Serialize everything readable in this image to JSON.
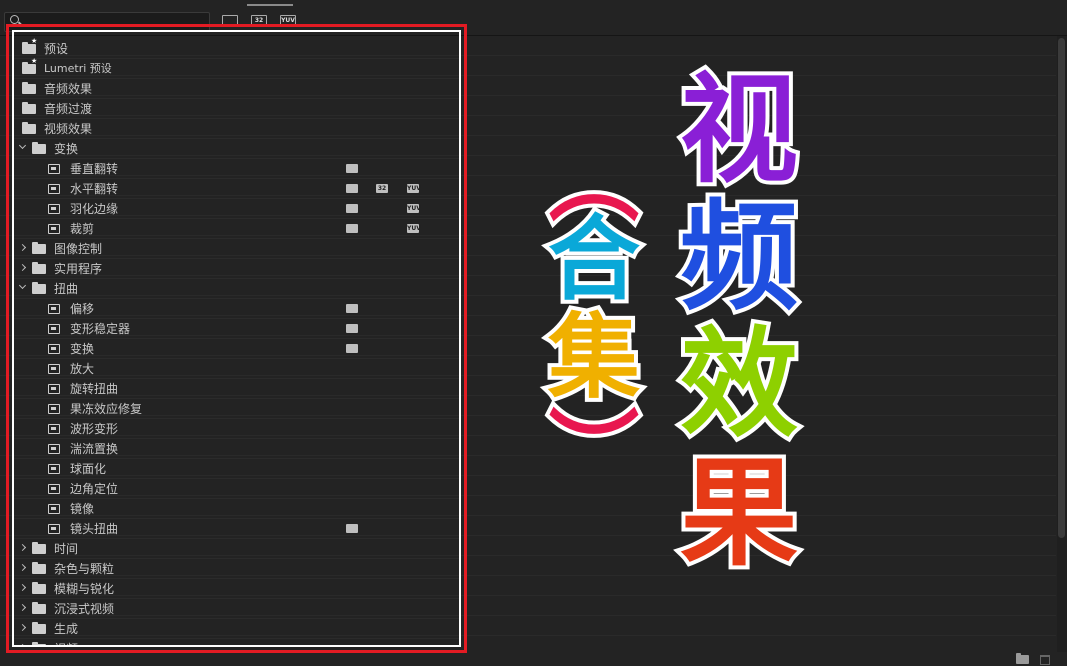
{
  "toolbar": {
    "search_placeholder": "",
    "filters": [
      {
        "label": "",
        "name": "accelerated-filter"
      },
      {
        "label": "32",
        "name": "32bit-filter"
      },
      {
        "label": "YUV",
        "name": "yuv-filter"
      }
    ]
  },
  "tree": [
    {
      "label": "预设",
      "indent": 0,
      "type": "folder-star",
      "chevron": "none",
      "badges": []
    },
    {
      "label": "Lumetri 预设",
      "indent": 0,
      "type": "folder-star",
      "chevron": "none",
      "badges": []
    },
    {
      "label": "音频效果",
      "indent": 0,
      "type": "folder",
      "chevron": "none",
      "badges": []
    },
    {
      "label": "音频过渡",
      "indent": 0,
      "type": "folder",
      "chevron": "none",
      "badges": []
    },
    {
      "label": "视频效果",
      "indent": 0,
      "type": "folder",
      "chevron": "none",
      "badges": []
    },
    {
      "label": "变换",
      "indent": 1,
      "type": "folder",
      "chevron": "expanded",
      "badges": []
    },
    {
      "label": "垂直翻转",
      "indent": 2,
      "type": "effect",
      "chevron": "none",
      "badges": [
        "accel"
      ]
    },
    {
      "label": "水平翻转",
      "indent": 2,
      "type": "effect",
      "chevron": "none",
      "badges": [
        "accel",
        "32",
        "yuv"
      ]
    },
    {
      "label": "羽化边缘",
      "indent": 2,
      "type": "effect",
      "chevron": "none",
      "badges": [
        "accel",
        "yuv"
      ]
    },
    {
      "label": "裁剪",
      "indent": 2,
      "type": "effect",
      "chevron": "none",
      "badges": [
        "accel",
        "yuv"
      ]
    },
    {
      "label": "图像控制",
      "indent": 1,
      "type": "folder",
      "chevron": "collapsed",
      "badges": []
    },
    {
      "label": "实用程序",
      "indent": 1,
      "type": "folder",
      "chevron": "collapsed",
      "badges": []
    },
    {
      "label": "扭曲",
      "indent": 1,
      "type": "folder",
      "chevron": "expanded",
      "badges": []
    },
    {
      "label": "偏移",
      "indent": 2,
      "type": "effect",
      "chevron": "none",
      "badges": [
        "accel"
      ]
    },
    {
      "label": "变形稳定器",
      "indent": 2,
      "type": "effect",
      "chevron": "none",
      "badges": [
        "accel"
      ]
    },
    {
      "label": "变换",
      "indent": 2,
      "type": "effect",
      "chevron": "none",
      "badges": [
        "accel"
      ]
    },
    {
      "label": "放大",
      "indent": 2,
      "type": "effect",
      "chevron": "none",
      "badges": []
    },
    {
      "label": "旋转扭曲",
      "indent": 2,
      "type": "effect",
      "chevron": "none",
      "badges": []
    },
    {
      "label": "果冻效应修复",
      "indent": 2,
      "type": "effect",
      "chevron": "none",
      "badges": []
    },
    {
      "label": "波形变形",
      "indent": 2,
      "type": "effect",
      "chevron": "none",
      "badges": []
    },
    {
      "label": "湍流置换",
      "indent": 2,
      "type": "effect",
      "chevron": "none",
      "badges": []
    },
    {
      "label": "球面化",
      "indent": 2,
      "type": "effect",
      "chevron": "none",
      "badges": []
    },
    {
      "label": "边角定位",
      "indent": 2,
      "type": "effect",
      "chevron": "none",
      "badges": []
    },
    {
      "label": "镜像",
      "indent": 2,
      "type": "effect",
      "chevron": "none",
      "badges": []
    },
    {
      "label": "镜头扭曲",
      "indent": 2,
      "type": "effect",
      "chevron": "none",
      "badges": [
        "accel"
      ]
    },
    {
      "label": "时间",
      "indent": 1,
      "type": "folder",
      "chevron": "collapsed",
      "badges": []
    },
    {
      "label": "杂色与颗粒",
      "indent": 1,
      "type": "folder",
      "chevron": "collapsed",
      "badges": []
    },
    {
      "label": "模糊与锐化",
      "indent": 1,
      "type": "folder",
      "chevron": "collapsed",
      "badges": []
    },
    {
      "label": "沉浸式视频",
      "indent": 1,
      "type": "folder",
      "chevron": "collapsed",
      "badges": []
    },
    {
      "label": "生成",
      "indent": 1,
      "type": "folder",
      "chevron": "collapsed",
      "badges": []
    },
    {
      "label": "视频",
      "indent": 1,
      "type": "folder",
      "chevron": "collapsed",
      "badges": []
    }
  ],
  "overlay": {
    "title_chars": [
      "视",
      "频",
      "效",
      "果"
    ],
    "subtitle_chars": [
      "合",
      "集"
    ],
    "paren_open": "︵",
    "paren_close": "︶"
  },
  "colors": {
    "highlight_border": "#e31b23",
    "inner_border": "#ffffff",
    "panel_bg": "#232323"
  }
}
